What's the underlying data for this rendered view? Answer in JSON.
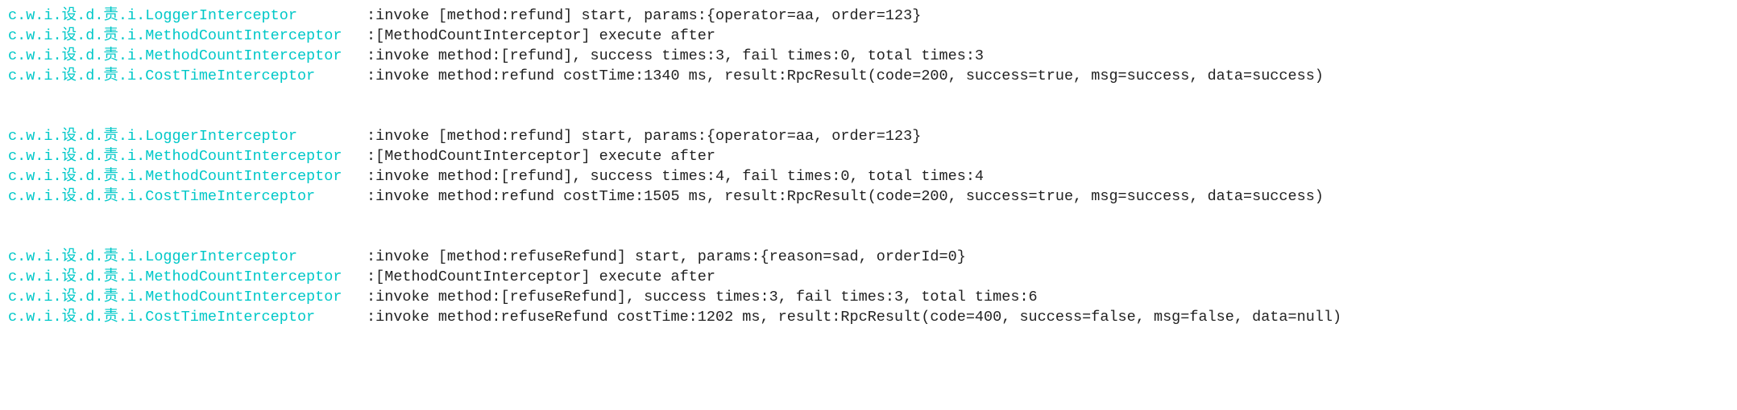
{
  "colors": {
    "logger": "#00c8c8",
    "text": "#222222"
  },
  "separator": ": ",
  "loggers": {
    "logger": "c.w.i.设.d.责.i.LoggerInterceptor",
    "methodCount": "c.w.i.设.d.责.i.MethodCountInterceptor",
    "costTime": "c.w.i.设.d.责.i.CostTimeInterceptor"
  },
  "blocks": [
    {
      "lines": [
        {
          "loggerKey": "logger",
          "message": "invoke [method:refund] start, params:{operator=aa, order=123}"
        },
        {
          "loggerKey": "methodCount",
          "message": "[MethodCountInterceptor] execute after"
        },
        {
          "loggerKey": "methodCount",
          "message": "invoke method:[refund], success times:3, fail times:0, total times:3"
        },
        {
          "loggerKey": "costTime",
          "message": "invoke method:refund costTime:1340 ms, result:RpcResult(code=200, success=true, msg=success, data=success)"
        }
      ]
    },
    {
      "lines": [
        {
          "loggerKey": "logger",
          "message": "invoke [method:refund] start, params:{operator=aa, order=123}"
        },
        {
          "loggerKey": "methodCount",
          "message": "[MethodCountInterceptor] execute after"
        },
        {
          "loggerKey": "methodCount",
          "message": "invoke method:[refund], success times:4, fail times:0, total times:4"
        },
        {
          "loggerKey": "costTime",
          "message": "invoke method:refund costTime:1505 ms, result:RpcResult(code=200, success=true, msg=success, data=success)"
        }
      ]
    },
    {
      "lines": [
        {
          "loggerKey": "logger",
          "message": "invoke [method:refuseRefund] start, params:{reason=sad, orderId=0}"
        },
        {
          "loggerKey": "methodCount",
          "message": "[MethodCountInterceptor] execute after"
        },
        {
          "loggerKey": "methodCount",
          "message": "invoke method:[refuseRefund], success times:3, fail times:3, total times:6"
        },
        {
          "loggerKey": "costTime",
          "message": "invoke method:refuseRefund costTime:1202 ms, result:RpcResult(code=400, success=false, msg=false, data=null)"
        }
      ]
    }
  ]
}
